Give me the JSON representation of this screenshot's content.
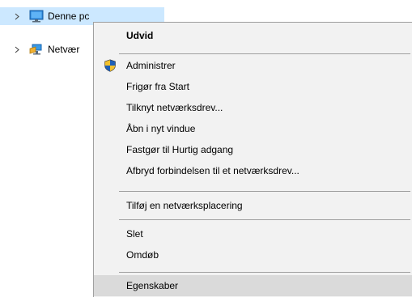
{
  "tree": {
    "items": [
      {
        "label": "Denne pc",
        "icon": "monitor-icon",
        "expander": "chevron-right-icon",
        "selected": true
      },
      {
        "label": "Netvær",
        "icon": "network-icon",
        "expander": "chevron-right-icon",
        "selected": false
      }
    ]
  },
  "menu": {
    "items": [
      {
        "label": "Udvid",
        "bold": true
      },
      {
        "label": "Administrer",
        "icon": "uac-shield-icon"
      },
      {
        "label": "Frigør fra Start"
      },
      {
        "label": "Tilknyt netværksdrev..."
      },
      {
        "label": "Åbn i nyt vindue"
      },
      {
        "label": "Fastgør til Hurtig adgang"
      },
      {
        "label": "Afbryd forbindelsen til et netværksdrev..."
      },
      {
        "label": "Tilføj en netværksplacering"
      },
      {
        "label": "Slet"
      },
      {
        "label": "Omdøb"
      },
      {
        "label": "Egenskaber",
        "highlighted": true
      }
    ]
  },
  "colors": {
    "selection": "#cce8ff",
    "menu_background": "#f2f2f2",
    "menu_hover": "#dadada",
    "separator": "#a0a0a0"
  }
}
